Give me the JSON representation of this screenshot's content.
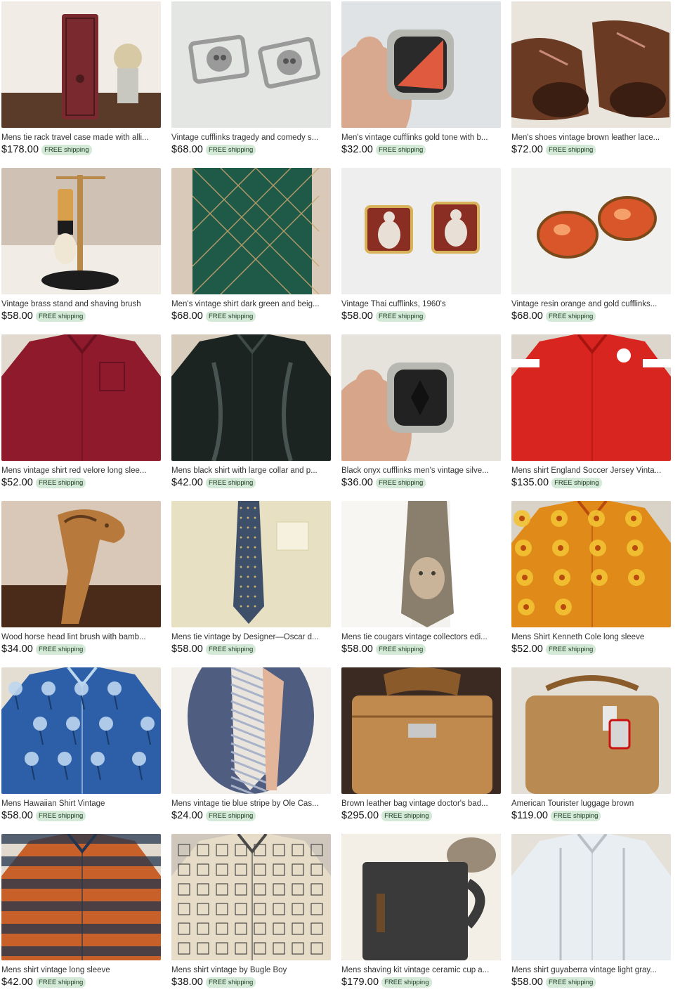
{
  "colors": {
    "badge_bg": "#d4e9d7",
    "badge_text": "#1a3a1f",
    "text": "#333333"
  },
  "listings": [
    {
      "title": "Mens tie rack travel case made with alli...",
      "price": "$178.00",
      "shipping": "FREE shipping",
      "image": "burgundy-leather-case",
      "colors": [
        "#f2ece6",
        "#7a2a2e",
        "#4a1a1c"
      ]
    },
    {
      "title": "Vintage cufflinks tragedy and comedy s...",
      "price": "$68.00",
      "shipping": "FREE shipping",
      "image": "silver-masks-cufflinks",
      "colors": [
        "#e3e6e2",
        "#9a9a9a",
        "#555555"
      ]
    },
    {
      "title": "Men's vintage cufflinks gold tone with b...",
      "price": "$32.00",
      "shipping": "FREE shipping",
      "image": "cufflink-in-hand",
      "colors": [
        "#dfe3e6",
        "#d8a98f",
        "#2a2a2a"
      ]
    },
    {
      "title": "Men's shoes vintage brown leather lace...",
      "price": "$72.00",
      "shipping": "FREE shipping",
      "image": "brown-leather-shoes",
      "colors": [
        "#e9e4dc",
        "#6b3a22",
        "#3b1e12"
      ]
    },
    {
      "title": "Vintage brass stand and shaving brush",
      "price": "$58.00",
      "shipping": "FREE shipping",
      "image": "shaving-brush-stand",
      "colors": [
        "#cfc1b3",
        "#b9894a",
        "#1c1c1c"
      ]
    },
    {
      "title": "Men's vintage shirt dark green and beig...",
      "price": "$68.00",
      "shipping": "FREE shipping",
      "image": "green-shirt",
      "colors": [
        "#d8c9b8",
        "#1f5a48",
        "#c9a56c"
      ]
    },
    {
      "title": "Vintage Thai cufflinks, 1960's",
      "price": "$58.00",
      "shipping": "FREE shipping",
      "image": "buddha-cufflinks",
      "colors": [
        "#eeeeee",
        "#8a2d22",
        "#e8e0d6"
      ]
    },
    {
      "title": "Vintage resin orange and gold cufflinks...",
      "price": "$68.00",
      "shipping": "FREE shipping",
      "image": "orange-resin-cufflinks",
      "colors": [
        "#f0f0ef",
        "#d9562a",
        "#7a4a1a"
      ]
    },
    {
      "title": "Mens vintage shirt red velore long slee...",
      "price": "$52.00",
      "shipping": "FREE shipping",
      "image": "red-velour-shirt",
      "colors": [
        "#e2d9cf",
        "#8e1a2c",
        "#6a1020"
      ]
    },
    {
      "title": "Mens black shirt with large collar and p...",
      "price": "$42.00",
      "shipping": "FREE shipping",
      "image": "black-satin-shirt",
      "colors": [
        "#d8ccbd",
        "#1c2422",
        "#3d4a46"
      ]
    },
    {
      "title": "Black onyx cufflinks men's vintage silve...",
      "price": "$36.00",
      "shipping": "FREE shipping",
      "image": "onyx-cufflink-in-hand",
      "colors": [
        "#e6e2dc",
        "#d7a58a",
        "#222222"
      ]
    },
    {
      "title": "Mens shirt England Soccer Jersey Vinta...",
      "price": "$135.00",
      "shipping": "FREE shipping",
      "image": "red-soccer-jersey",
      "colors": [
        "#ddd6cc",
        "#d9251f",
        "#a8140f"
      ]
    },
    {
      "title": "Wood horse head lint brush with bamb...",
      "price": "$34.00",
      "shipping": "FREE shipping",
      "image": "wooden-horse-brush",
      "colors": [
        "#d9c8b8",
        "#b87a3c",
        "#5e3a1a"
      ]
    },
    {
      "title": "Mens tie vintage by Designer—Oscar d...",
      "price": "$58.00",
      "shipping": "FREE shipping",
      "image": "blue-tie-on-shirt",
      "colors": [
        "#f2ecd6",
        "#3e4f6a",
        "#e8e0c2"
      ]
    },
    {
      "title": "Mens tie cougars vintage collectors edi...",
      "price": "$58.00",
      "shipping": "FREE shipping",
      "image": "cougar-tie",
      "colors": [
        "#f3f2ee",
        "#8a7e6c",
        "#3e3a34"
      ]
    },
    {
      "title": "Mens Shirt Kenneth Cole long sleeve",
      "price": "$52.00",
      "shipping": "FREE shipping",
      "image": "orange-floral-shirt",
      "colors": [
        "#d9d2c6",
        "#e08a1a",
        "#b84a0e"
      ]
    },
    {
      "title": "Mens Hawaiian Shirt Vintage",
      "price": "$58.00",
      "shipping": "FREE shipping",
      "image": "blue-hawaiian-shirt",
      "colors": [
        "#e4ddd2",
        "#2d5fa8",
        "#bcd6ee"
      ]
    },
    {
      "title": "Mens vintage tie blue stripe by Ole Cas...",
      "price": "$24.00",
      "shipping": "FREE shipping",
      "image": "striped-tie-mannequin",
      "colors": [
        "#f3efea",
        "#e9e4de",
        "#4f5d80"
      ]
    },
    {
      "title": "Brown leather bag vintage doctor's bad...",
      "price": "$295.00",
      "shipping": "FREE shipping",
      "image": "tan-leather-bag",
      "colors": [
        "#3a2a22",
        "#c08a4f",
        "#8a5a2a"
      ]
    },
    {
      "title": "American Tourister luggage brown",
      "price": "$119.00",
      "shipping": "FREE shipping",
      "image": "brown-travel-bag",
      "colors": [
        "#e3ded6",
        "#b98a52",
        "#8a5c2c"
      ]
    },
    {
      "title": "Mens shirt vintage long sleeve",
      "price": "$42.00",
      "shipping": "FREE shipping",
      "image": "patterned-shirt",
      "colors": [
        "#e2d9cf",
        "#c8602a",
        "#24354f"
      ]
    },
    {
      "title": "Mens shirt vintage by Bugle Boy",
      "price": "$38.00",
      "shipping": "FREE shipping",
      "image": "beige-print-shirt",
      "colors": [
        "#cfc6bc",
        "#e6dcc8",
        "#4a4a48"
      ]
    },
    {
      "title": "Mens shaving kit vintage ceramic cup a...",
      "price": "$179.00",
      "shipping": "FREE shipping",
      "image": "shaving-kit-mug",
      "colors": [
        "#b0121a",
        "#f4efe6",
        "#3a3a3a"
      ]
    },
    {
      "title": "Mens shirt guyaberra vintage light gray...",
      "price": "$58.00",
      "shipping": "FREE shipping",
      "image": "light-guayabera-shirt",
      "colors": [
        "#e5e0d8",
        "#e9eef2",
        "#b8c0c6"
      ]
    }
  ]
}
